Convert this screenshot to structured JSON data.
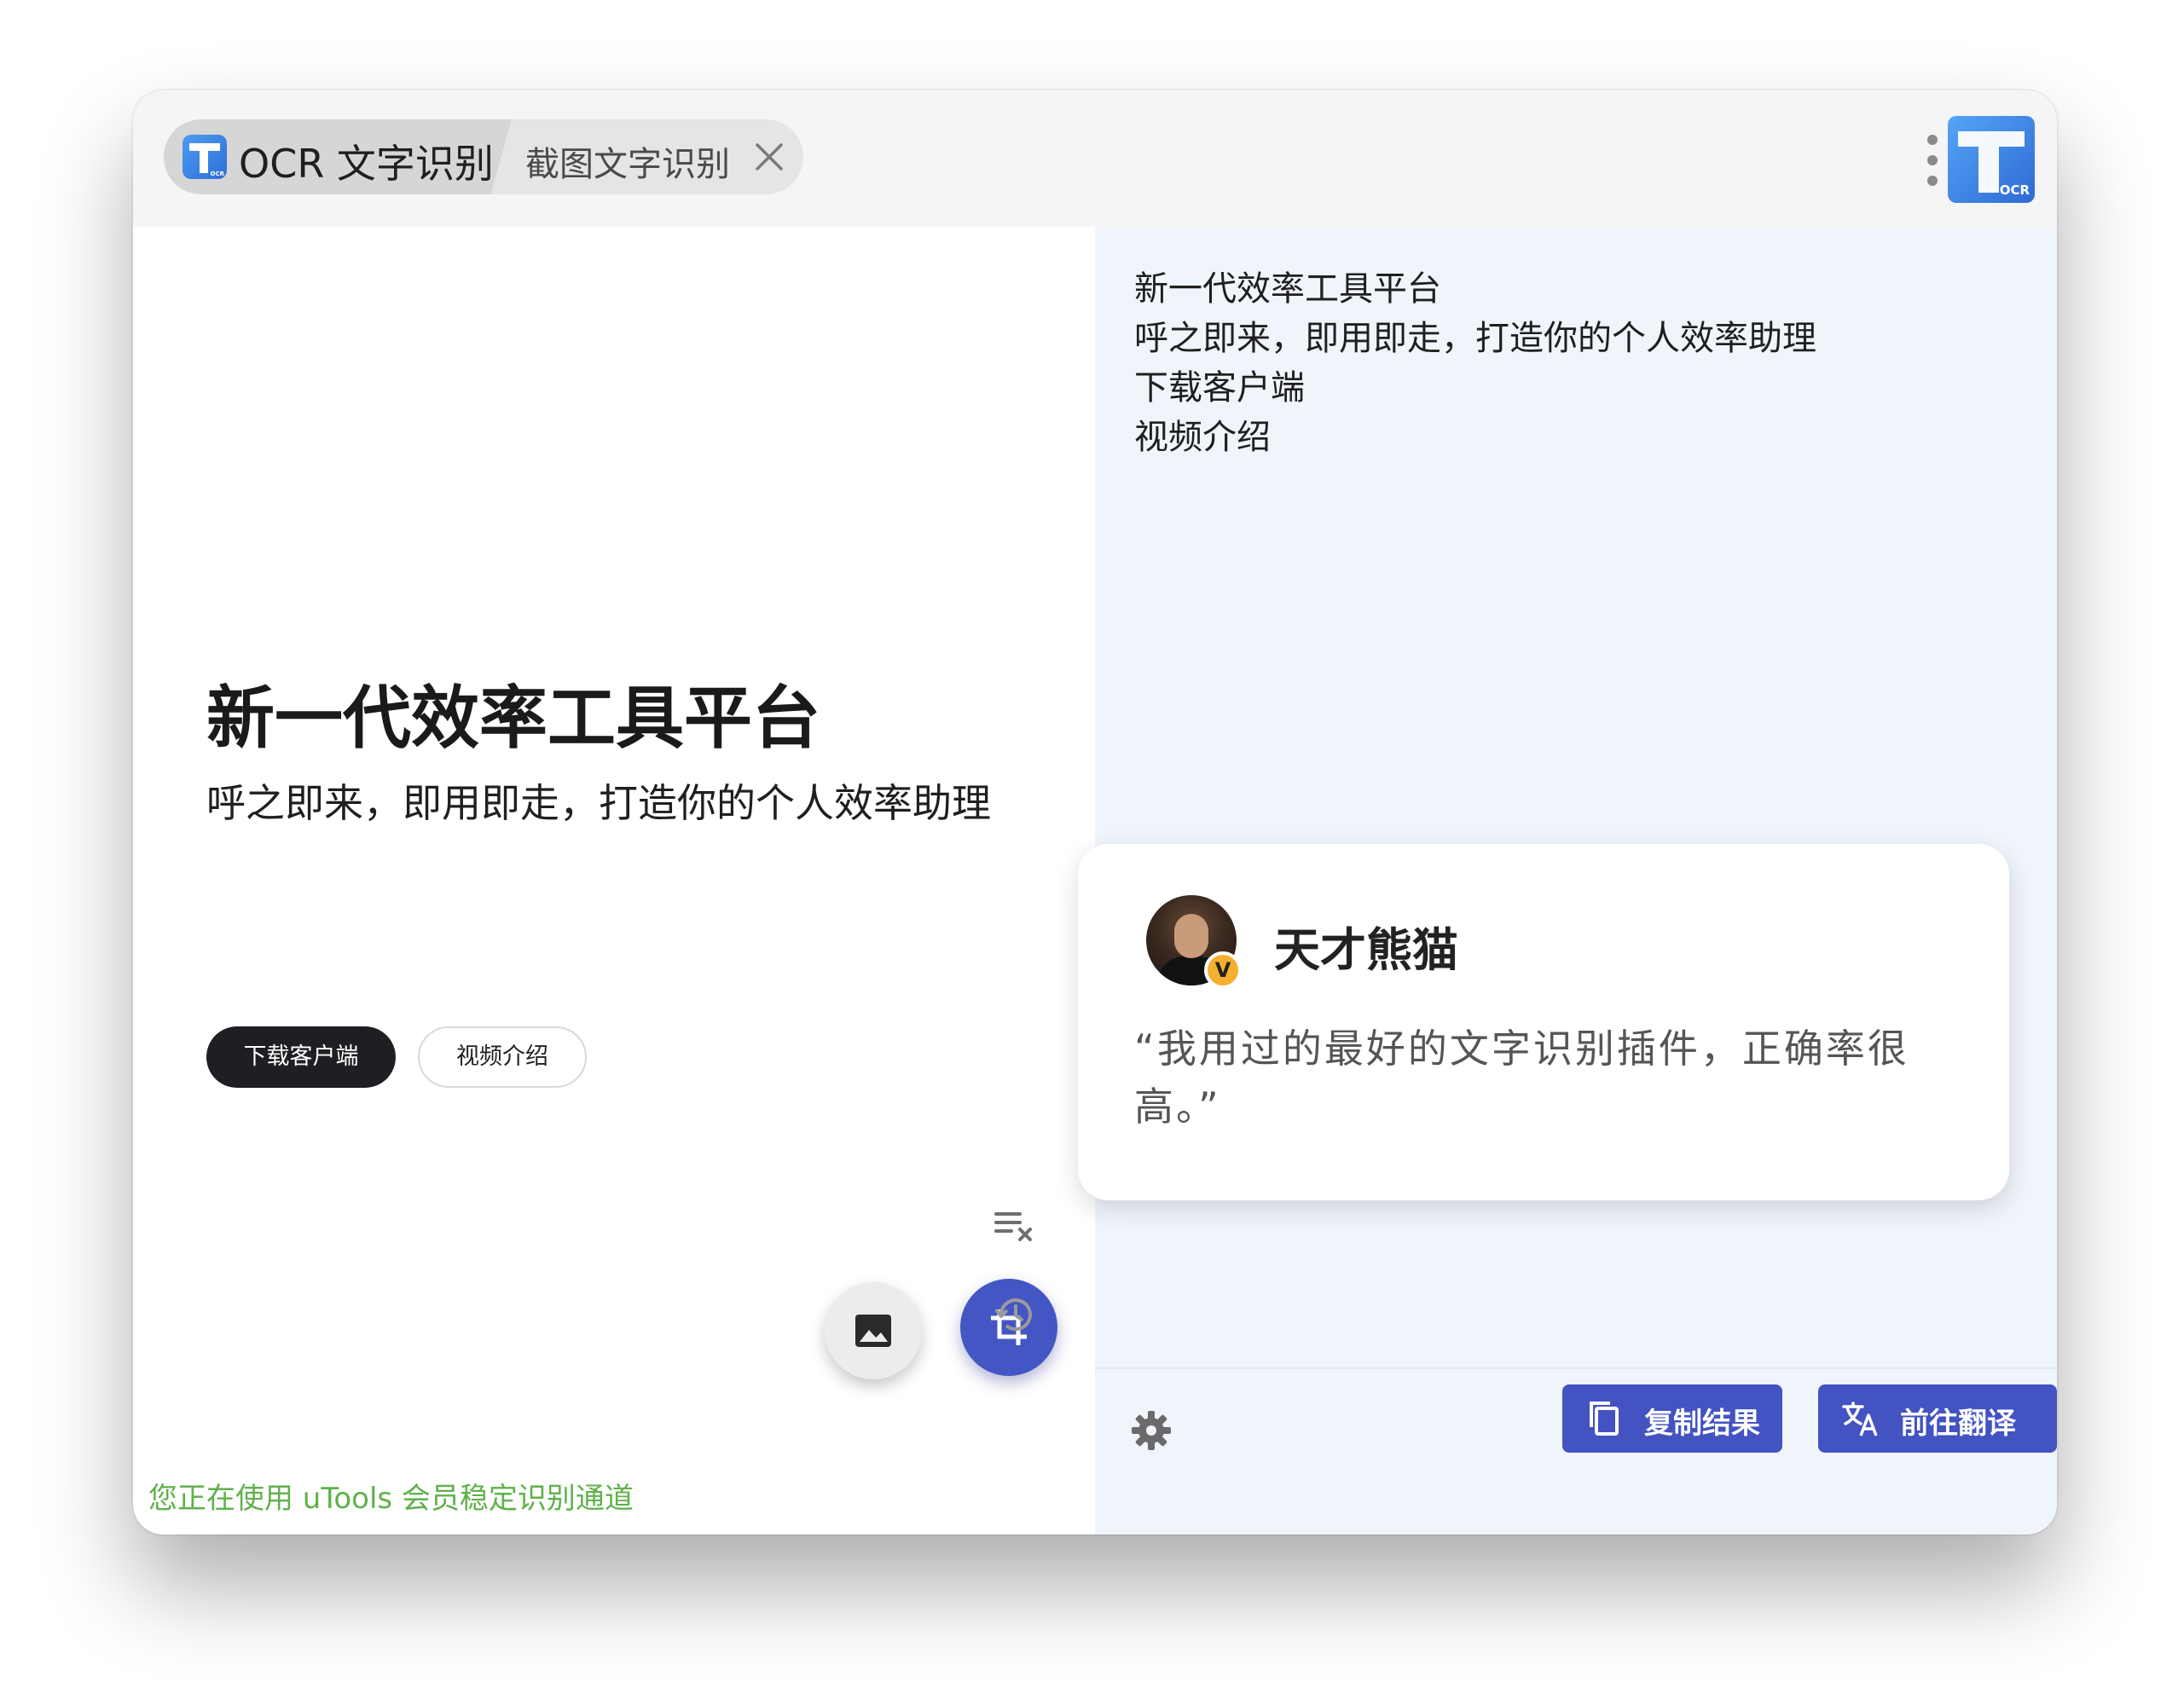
{
  "tabs": {
    "main_title": "OCR 文字识别",
    "sub_title": "截图文字识别"
  },
  "app_logo": {
    "label": "OCR"
  },
  "preview": {
    "heading": "新一代效率工具平台",
    "subheading": "呼之即来，即用即走，打造你的个人效率助理",
    "primary_button": "下载客户端",
    "secondary_button": "视频介绍",
    "status_text": "您正在使用 uTools 会员稳定识别通道"
  },
  "result": {
    "lines": [
      "新一代效率工具平台",
      "呼之即来，即用即走，打造你的个人效率助理",
      "下载客户端",
      "视频介绍"
    ]
  },
  "review_card": {
    "name": "天才熊猫",
    "badge": "V",
    "quote": "“我用过的最好的文字识别插件，正确率很高。”"
  },
  "actions": {
    "copy_label": "复制结果",
    "translate_label": "前往翻译"
  },
  "colors": {
    "accent": "#4353c2",
    "status_green": "#5fb14a",
    "result_bg": "#f0f4fb"
  },
  "icons": [
    "close-icon",
    "more-vert-icon",
    "image-icon",
    "crop-icon",
    "clear-list-icon",
    "history-icon",
    "settings-gear-icon",
    "copy-icon",
    "translate-icon"
  ]
}
